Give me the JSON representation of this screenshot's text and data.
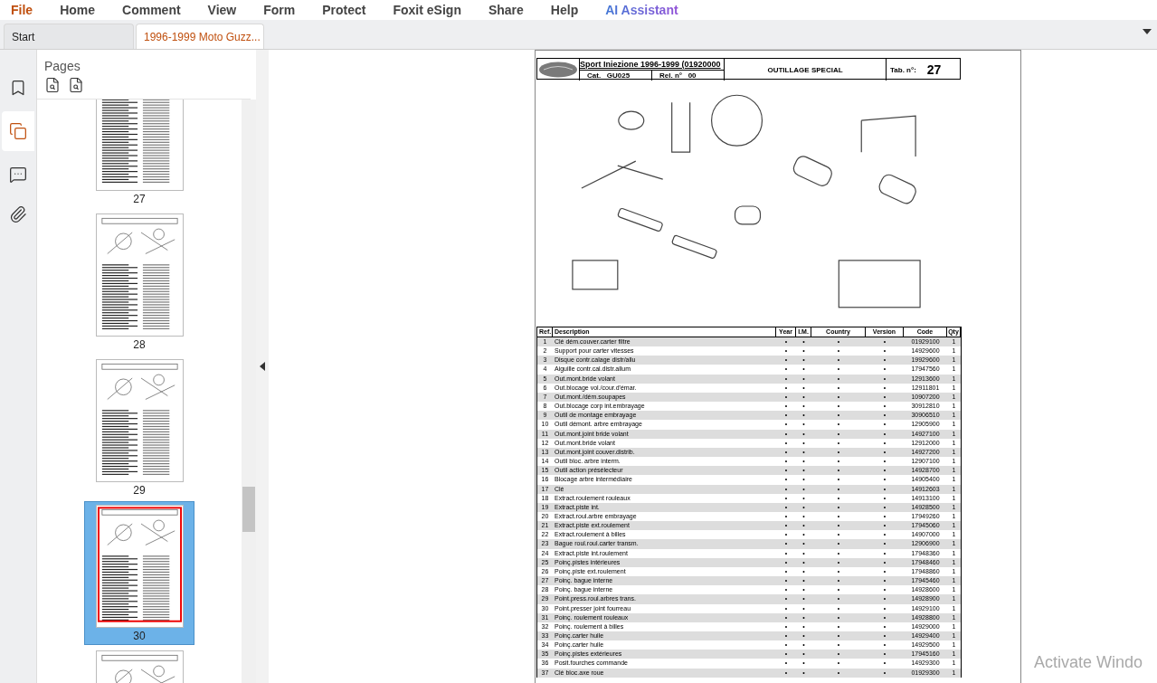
{
  "menu": [
    {
      "label": "File",
      "kind": "file"
    },
    {
      "label": "Home",
      "kind": "plain"
    },
    {
      "label": "Comment",
      "kind": "plain"
    },
    {
      "label": "View",
      "kind": "plain"
    },
    {
      "label": "Form",
      "kind": "plain"
    },
    {
      "label": "Protect",
      "kind": "plain"
    },
    {
      "label": "Foxit eSign",
      "kind": "plain"
    },
    {
      "label": "Share",
      "kind": "plain"
    },
    {
      "label": "Help",
      "kind": "plain"
    },
    {
      "label": "AI Assistant",
      "kind": "ai"
    }
  ],
  "tabs": [
    {
      "label": "Start",
      "selected": false
    },
    {
      "label": "1996-1999 Moto Guzz...",
      "selected": true
    }
  ],
  "side_rail": [
    {
      "kind": "bookmarks",
      "selected": false
    },
    {
      "kind": "pages",
      "selected": true
    },
    {
      "kind": "comments",
      "selected": false
    },
    {
      "kind": "attachments",
      "selected": false
    }
  ],
  "pages_panel": {
    "title": "Pages",
    "thumbnails": [
      {
        "label": "27",
        "kind": "table",
        "selected": false
      },
      {
        "label": "28",
        "kind": "mixed",
        "selected": false
      },
      {
        "label": "29",
        "kind": "mixed",
        "selected": false
      },
      {
        "label": "30",
        "kind": "mixed",
        "selected": true
      },
      {
        "kind": "mixed",
        "selected": false
      }
    ]
  },
  "document": {
    "header": {
      "model": "Sport Iniezione 1996-1999 (01920000",
      "cat_label": "Cat.",
      "cat": "GU025",
      "rel_label": "Rel. n°",
      "rel": "00",
      "title": "OUTILLAGE SPECIAL",
      "tab_label": "Tab. n°:",
      "tab": "27"
    },
    "table": {
      "columns": [
        "Ref.",
        "Description",
        "Year",
        "I.M.",
        "Country",
        "Version",
        "Code",
        "Qty"
      ],
      "rows": [
        [
          "1",
          "Clé dém.couver.carter filtre",
          "•",
          "•",
          "•",
          "•",
          "01929100",
          "1"
        ],
        [
          "2",
          "Support pour carter vitesses",
          "•",
          "•",
          "•",
          "•",
          "14929600",
          "1"
        ],
        [
          "3",
          "Disque contr.calage distr/allu",
          "•",
          "•",
          "•",
          "•",
          "19929600",
          "1"
        ],
        [
          "4",
          "Aiguille contr.cal.distr.allum",
          "•",
          "•",
          "•",
          "•",
          "17947560",
          "1"
        ],
        [
          "5",
          "Out.mont.bride volant",
          "•",
          "•",
          "•",
          "•",
          "12913600",
          "1"
        ],
        [
          "6",
          "Out.blocage vol./cour.d'émar.",
          "•",
          "•",
          "•",
          "•",
          "12911801",
          "1"
        ],
        [
          "7",
          "Out.mont./dém.soupapes",
          "•",
          "•",
          "•",
          "•",
          "10907200",
          "1"
        ],
        [
          "8",
          "Out.blocage corp int.embrayage",
          "•",
          "•",
          "•",
          "•",
          "30912810",
          "1"
        ],
        [
          "9",
          "Outil de montage embrayage",
          "•",
          "•",
          "•",
          "•",
          "30906510",
          "1"
        ],
        [
          "10",
          "Outil démont. arbre embrayage",
          "•",
          "•",
          "•",
          "•",
          "12905900",
          "1"
        ],
        [
          "11",
          "Out.mont.joint bride volant",
          "•",
          "•",
          "•",
          "•",
          "14927100",
          "1"
        ],
        [
          "12",
          "Out.mont.bride volant",
          "•",
          "•",
          "•",
          "•",
          "12912000",
          "1"
        ],
        [
          "13",
          "Out.mont.joint couver.distrib.",
          "•",
          "•",
          "•",
          "•",
          "14927200",
          "1"
        ],
        [
          "14",
          "Outil bloc. arbre interm.",
          "•",
          "•",
          "•",
          "•",
          "12907100",
          "1"
        ],
        [
          "15",
          "Outil action présélecteur",
          "•",
          "•",
          "•",
          "•",
          "14928700",
          "1"
        ],
        [
          "16",
          "Blocage arbre intermédiaire",
          "•",
          "•",
          "•",
          "•",
          "14905400",
          "1"
        ],
        [
          "17",
          "Clé",
          "•",
          "•",
          "•",
          "•",
          "14912603",
          "1"
        ],
        [
          "18",
          "Extract.roulement rouleaux",
          "•",
          "•",
          "•",
          "•",
          "14913100",
          "1"
        ],
        [
          "19",
          "Extract.piste int.",
          "•",
          "•",
          "•",
          "•",
          "14928500",
          "1"
        ],
        [
          "20",
          "Extract.roul.arbre embrayage",
          "•",
          "•",
          "•",
          "•",
          "17949260",
          "1"
        ],
        [
          "21",
          "Extract.piste ext.roulement",
          "•",
          "•",
          "•",
          "•",
          "17945060",
          "1"
        ],
        [
          "22",
          "Extract.roulement à billes",
          "•",
          "•",
          "•",
          "•",
          "14907000",
          "1"
        ],
        [
          "23",
          "Bague roul.roul.carter transm.",
          "•",
          "•",
          "•",
          "•",
          "12906900",
          "1"
        ],
        [
          "24",
          "Extract.piste int.roulement",
          "•",
          "•",
          "•",
          "•",
          "17948360",
          "1"
        ],
        [
          "25",
          "Poinç.pistes intérieures",
          "•",
          "•",
          "•",
          "•",
          "17948460",
          "1"
        ],
        [
          "26",
          "Poinç.piste ext.roulement",
          "•",
          "•",
          "•",
          "•",
          "17948860",
          "1"
        ],
        [
          "27",
          "Poinç. bague interne",
          "•",
          "•",
          "•",
          "•",
          "17945460",
          "1"
        ],
        [
          "28",
          "Poinç. bague interne",
          "•",
          "•",
          "•",
          "•",
          "14928600",
          "1"
        ],
        [
          "29",
          "Point.press.roul.arbres trans.",
          "•",
          "•",
          "•",
          "•",
          "14928900",
          "1"
        ],
        [
          "30",
          "Point.presser joint fourreau",
          "•",
          "•",
          "•",
          "•",
          "14929100",
          "1"
        ],
        [
          "31",
          "Poinç. roulement rouleaux",
          "•",
          "•",
          "•",
          "•",
          "14928800",
          "1"
        ],
        [
          "32",
          "Poinç. roulement à billes",
          "•",
          "•",
          "•",
          "•",
          "14929000",
          "1"
        ],
        [
          "33",
          "Poinç.carter huile",
          "•",
          "•",
          "•",
          "•",
          "14929400",
          "1"
        ],
        [
          "34",
          "Poinç.carter huile",
          "•",
          "•",
          "•",
          "•",
          "14929500",
          "1"
        ],
        [
          "35",
          "Poinç.pistes extérieures",
          "•",
          "•",
          "•",
          "•",
          "17945160",
          "1"
        ],
        [
          "36",
          "Posit.fourches commande",
          "•",
          "•",
          "•",
          "•",
          "14929300",
          "1"
        ],
        [
          "37",
          "Clé bloc.axe roue",
          "•",
          "•",
          "•",
          "•",
          "01929300",
          "1"
        ]
      ]
    }
  },
  "os_notice": {
    "text": "Activate Windo"
  }
}
